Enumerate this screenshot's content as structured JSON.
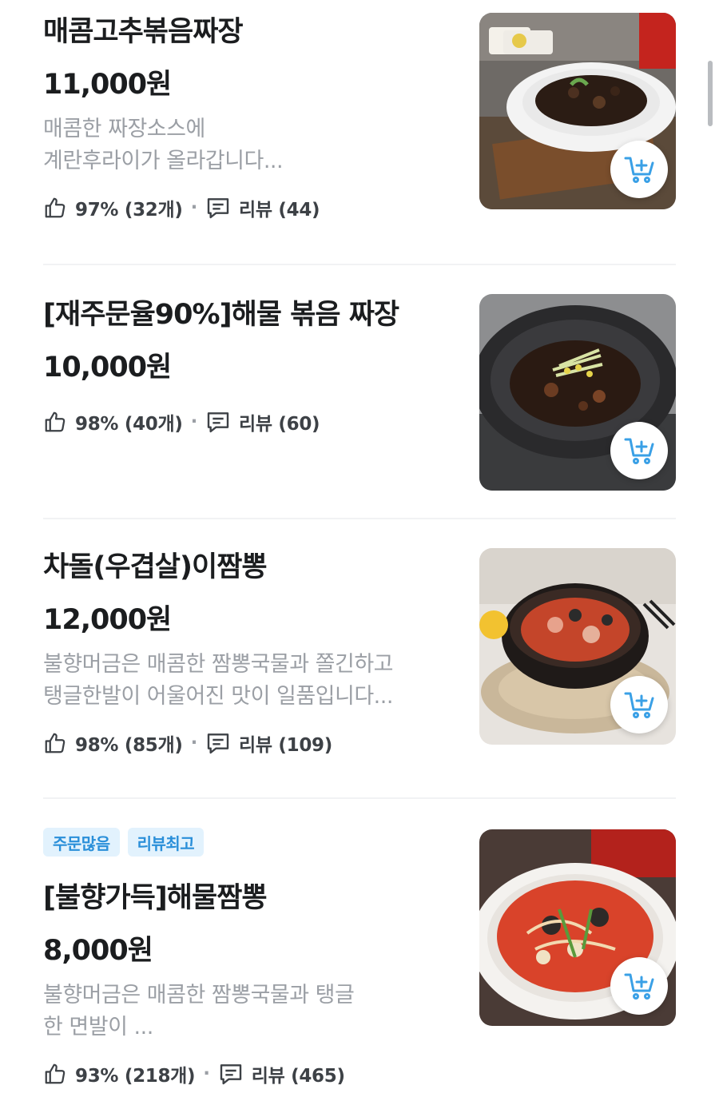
{
  "items": [
    {
      "name": "매콤고추볶음짜장",
      "price": "11,000원",
      "desc_lines": [
        "매콤한 짜장소스에",
        "계란후라이가 올라갑니다..."
      ],
      "rating": "97% (32개)",
      "review": "리뷰 (44)"
    },
    {
      "name": "[재주문율90%]해물 볶음 짜장",
      "price": "10,000원",
      "desc_lines": [],
      "rating": "98% (40개)",
      "review": "리뷰 (60)"
    },
    {
      "name": "차돌(우겹살)이짬뽕",
      "price": "12,000원",
      "desc_lines": [
        "불향머금은 매콤한 짬뽕국물과 쫄긴하고",
        "탱글한발이 어울어진 맛이 일품입니다..."
      ],
      "rating": "98% (85개)",
      "review": "리뷰 (109)"
    },
    {
      "tags": [
        "주문많음",
        "리뷰최고"
      ],
      "name": "[불향가득]해물짬뽕",
      "price": "8,000원",
      "desc_lines": [
        "불향머금은 매콤한 짬뽕국물과 탱글",
        "한 면발이 ..."
      ],
      "rating": "93% (218개)",
      "review": "리뷰 (465)"
    }
  ],
  "separator": "·",
  "icons": {
    "like": "thumbs-up-icon",
    "review": "speech-bubble-icon",
    "cart": "cart-add-icon"
  },
  "colors": {
    "tag_bg": "#e2f2fd",
    "tag_text": "#2a8fd9",
    "cart_icon": "#3aa0e6",
    "desc_text": "#9b9fa5"
  }
}
